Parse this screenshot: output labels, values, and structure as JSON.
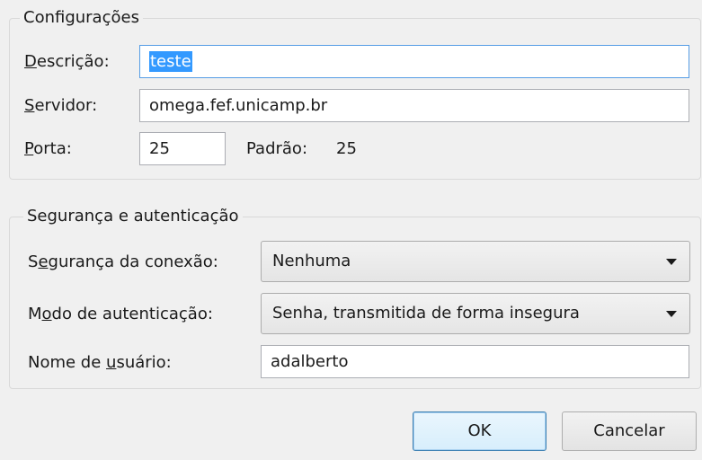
{
  "settings": {
    "legend": "Configurações",
    "description_label": "Descrição:",
    "description_value": "teste",
    "server_label": "Servidor:",
    "server_value": "omega.fef.unicamp.br",
    "port_label": "Porta:",
    "port_value": "25",
    "default_label": "Padrão:",
    "default_value": "25"
  },
  "security": {
    "legend": "Segurança e autenticação",
    "connection_security_label": "Segurança da conexão:",
    "connection_security_value": "Nenhuma",
    "auth_mode_label": "Modo de autenticação:",
    "auth_mode_value": "Senha, transmitida de forma insegura",
    "username_label": "Nome de usuário:",
    "username_value": "adalberto"
  },
  "buttons": {
    "ok_label": "OK",
    "cancel_label": "Cancelar"
  },
  "colors": {
    "selection": "#3399ff",
    "focus_border": "#569de5",
    "window_bg": "#f0f0f0"
  },
  "icons": {
    "combo_arrow": "chevron-down-icon"
  }
}
